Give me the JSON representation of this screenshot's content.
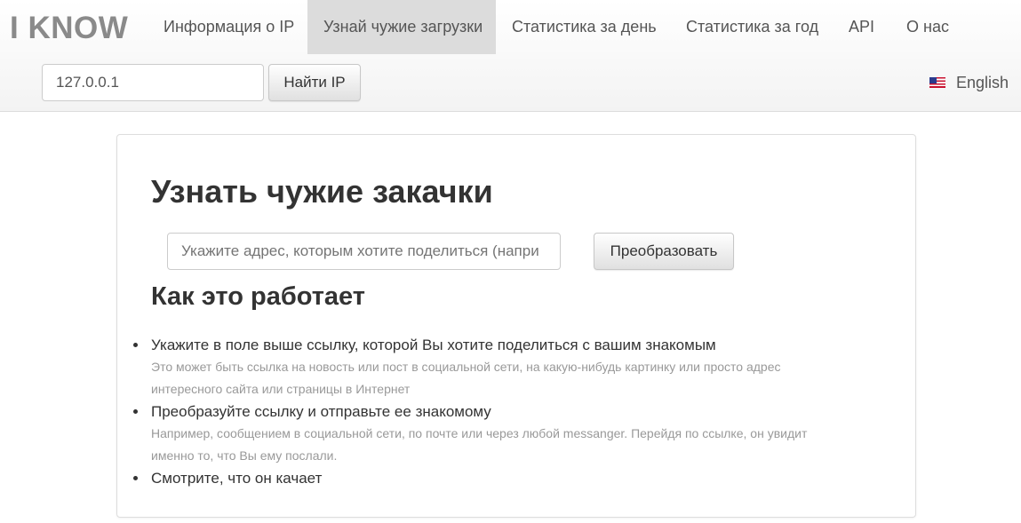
{
  "header": {
    "logo": "I KNOW",
    "nav": [
      {
        "label": "Информация о IP"
      },
      {
        "label": "Узнай чужие загрузки"
      },
      {
        "label": "Статистика за день"
      },
      {
        "label": "Статистика за год"
      },
      {
        "label": "API"
      },
      {
        "label": "О нас"
      }
    ],
    "active_nav": "Узнай чужие загрузки",
    "ip_input_value": "127.0.0.1",
    "find_button": "Найти IP",
    "language": "English",
    "language_icon": "us-flag-icon"
  },
  "main": {
    "title": "Узнать чужие закачки",
    "url_placeholder": "Укажите адрес, которым хотите поделиться (например, ссылку)",
    "url_placeholder_visible": "Укажите адрес, которым хотите поделиться (напри",
    "convert_button": "Преобразовать",
    "section_title": "Как это работает",
    "steps": [
      {
        "title": "Укажите в поле выше ссылку, которой Вы хотите поделиться с вашим знакомым",
        "desc": "Это может быть ссылка на новость или пост в социальной сети, на какую-нибудь картинку или просто адрес интересного сайта или страницы в Интернет"
      },
      {
        "title": "Преобразуйте ссылку и отправьте ее знакомому",
        "desc": "Например, сообщением в социальной сети, по почте или через любой messanger. Перейдя по ссылке, он увидит именно то, что Вы ему послали."
      },
      {
        "title": "Смотрите, что он качает",
        "desc": ""
      }
    ]
  },
  "colors": {
    "logo": "#8a8a8a",
    "active_nav_bg": "#dcdcdc",
    "text": "#333333",
    "muted_text": "#999999",
    "border": "#dddddd"
  }
}
